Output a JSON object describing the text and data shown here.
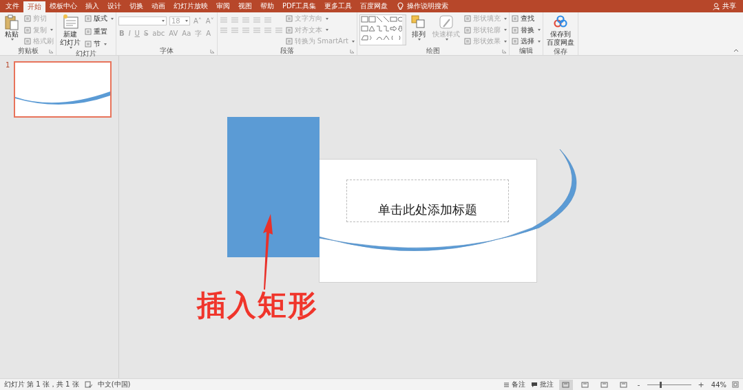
{
  "tabs": [
    {
      "label": "文件",
      "selected": false
    },
    {
      "label": "开始",
      "selected": true
    },
    {
      "label": "模板中心",
      "selected": false
    },
    {
      "label": "插入",
      "selected": false
    },
    {
      "label": "设计",
      "selected": false
    },
    {
      "label": "切换",
      "selected": false
    },
    {
      "label": "动画",
      "selected": false
    },
    {
      "label": "幻灯片放映",
      "selected": false
    },
    {
      "label": "审阅",
      "selected": false
    },
    {
      "label": "视图",
      "selected": false
    },
    {
      "label": "帮助",
      "selected": false
    },
    {
      "label": "PDF工具集",
      "selected": false
    },
    {
      "label": "更多工具",
      "selected": false
    },
    {
      "label": "百度网盘",
      "selected": false
    }
  ],
  "tell_me": "操作说明搜索",
  "share": "共享",
  "ribbon": [
    {
      "label": "剪贴板",
      "launcher": true,
      "columns": [
        {
          "kind": "large",
          "label": "粘贴",
          "menu": true,
          "disabled": false
        },
        {
          "kind": "stack",
          "items": [
            {
              "label": "剪切",
              "menu": false,
              "disabled": true
            },
            {
              "label": "复制",
              "menu": true,
              "disabled": true
            },
            {
              "label": "格式刷",
              "menu": false,
              "disabled": true
            }
          ]
        }
      ]
    },
    {
      "label": "幻灯片",
      "launcher": false,
      "columns": [
        {
          "kind": "large",
          "label_lines": [
            "新建",
            "幻灯片"
          ],
          "menu": true,
          "disabled": false
        },
        {
          "kind": "stack",
          "items": [
            {
              "label": "版式",
              "menu": true,
              "disabled": false
            },
            {
              "label": "重置",
              "menu": false,
              "disabled": false
            },
            {
              "label": "节",
              "menu": true,
              "disabled": false
            }
          ]
        }
      ]
    },
    {
      "label": "字体",
      "launcher": true,
      "columns": [
        {
          "kind": "font",
          "disabled": true,
          "font_size": "18",
          "size_buttons": [
            "A˄",
            "A˅"
          ],
          "format_buttons": [
            "B",
            "I",
            "U",
            "S",
            "abc",
            "AV",
            "Aa",
            "字",
            "A"
          ]
        }
      ]
    },
    {
      "label": "段落",
      "launcher": true,
      "columns": [
        {
          "kind": "paragraph",
          "disabled": true
        },
        {
          "kind": "stack",
          "items": [
            {
              "label": "文字方向",
              "menu": true,
              "disabled": true
            },
            {
              "label": "对齐文本",
              "menu": true,
              "disabled": true
            },
            {
              "label": "转换为 SmartArt",
              "menu": true,
              "disabled": true
            }
          ]
        }
      ]
    },
    {
      "label": "绘图",
      "launcher": true,
      "columns": [
        {
          "kind": "gallery"
        },
        {
          "kind": "large",
          "label": "排列",
          "menu": true,
          "disabled": false
        },
        {
          "kind": "large",
          "label": "快速样式",
          "menu": true,
          "disabled": true
        },
        {
          "kind": "stack",
          "items": [
            {
              "label": "形状填充",
              "menu": true,
              "disabled": true
            },
            {
              "label": "形状轮廓",
              "menu": true,
              "disabled": true
            },
            {
              "label": "形状效果",
              "menu": true,
              "disabled": true
            }
          ]
        }
      ]
    },
    {
      "label": "编辑",
      "launcher": false,
      "columns": [
        {
          "kind": "stack",
          "items": [
            {
              "label": "查找",
              "menu": false,
              "disabled": false
            },
            {
              "label": "替换",
              "menu": true,
              "disabled": false
            },
            {
              "label": "选择",
              "menu": true,
              "disabled": false
            }
          ]
        }
      ]
    },
    {
      "label": "保存",
      "launcher": false,
      "columns": [
        {
          "kind": "large",
          "label_lines": [
            "保存到",
            "百度网盘"
          ],
          "menu": false,
          "disabled": false
        }
      ]
    }
  ],
  "slides": [
    {
      "number": "1",
      "selected": true
    }
  ],
  "slide": {
    "title_placeholder": "单击此处添加标题"
  },
  "annotation": {
    "text": "插入矩形"
  },
  "status_bar": {
    "slide_info": "幻灯片 第 1 张，共 1 张",
    "language": "中文(中国)",
    "notes": "备注",
    "comments": "批注",
    "views": [
      {
        "selected": true
      },
      {
        "selected": false
      },
      {
        "selected": false
      },
      {
        "selected": false
      }
    ],
    "zoom": {
      "minus": "-",
      "level": 0.3,
      "plus": "+",
      "reading": "44%"
    }
  }
}
